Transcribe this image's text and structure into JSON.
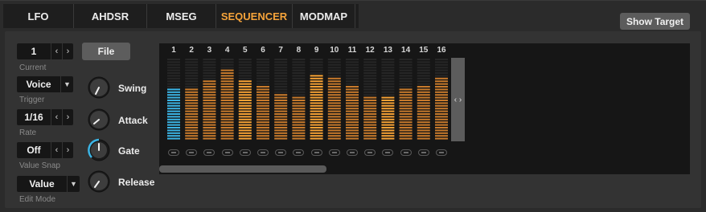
{
  "tabs": [
    {
      "label": "LFO",
      "active": false
    },
    {
      "label": "AHDSR",
      "active": false
    },
    {
      "label": "MSEG",
      "active": false
    },
    {
      "label": "SEQUENCER",
      "active": true
    },
    {
      "label": "MODMAP",
      "active": false
    }
  ],
  "show_target_label": "Show Target",
  "controls": {
    "current": {
      "value": "1",
      "label": "Current"
    },
    "file_label": "File",
    "trigger": {
      "value": "Voice",
      "label": "Trigger"
    },
    "rate": {
      "value": "1/16",
      "label": "Rate"
    },
    "value_snap": {
      "value": "Off",
      "label": "Value Snap"
    },
    "edit_mode": {
      "value": "Value",
      "label": "Edit Mode"
    },
    "knobs": {
      "swing": "Swing",
      "attack": "Attack",
      "gate": "Gate",
      "release": "Release"
    }
  },
  "colors": {
    "accent": "#f5a33a",
    "bar": "#c77a2c",
    "bar_highlight": "#f7a235",
    "current_step": "#3bb5e6",
    "gate_ring": "#3bb5e6"
  },
  "sequencer": {
    "steps": [
      {
        "num": "1",
        "level": 0.62,
        "current": true
      },
      {
        "num": "2",
        "level": 0.62,
        "current": false
      },
      {
        "num": "3",
        "level": 0.73,
        "current": false
      },
      {
        "num": "4",
        "level": 0.88,
        "current": false
      },
      {
        "num": "5",
        "level": 0.74,
        "current": false,
        "highlight": true
      },
      {
        "num": "6",
        "level": 0.66,
        "current": false
      },
      {
        "num": "7",
        "level": 0.58,
        "current": false
      },
      {
        "num": "8",
        "level": 0.54,
        "current": false
      },
      {
        "num": "9",
        "level": 0.8,
        "current": false,
        "highlight": true
      },
      {
        "num": "10",
        "level": 0.78,
        "current": false
      },
      {
        "num": "11",
        "level": 0.66,
        "current": false
      },
      {
        "num": "12",
        "level": 0.54,
        "current": false
      },
      {
        "num": "13",
        "level": 0.52,
        "current": false,
        "highlight": true
      },
      {
        "num": "14",
        "level": 0.62,
        "current": false
      },
      {
        "num": "15",
        "level": 0.68,
        "current": false
      },
      {
        "num": "16",
        "level": 0.76,
        "current": false
      }
    ]
  }
}
